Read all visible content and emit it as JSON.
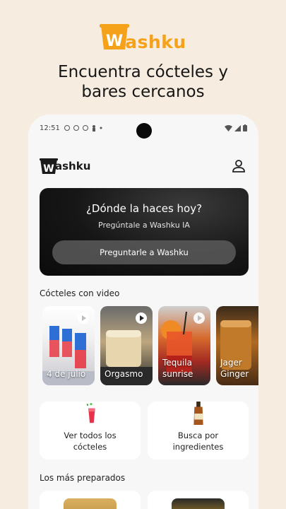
{
  "promo": {
    "brand_word": "ashku",
    "headline_line1": "Encuentra cócteles y",
    "headline_line2": "bares cercanos"
  },
  "status_bar": {
    "time": "12:51"
  },
  "app_bar": {
    "brand_word": "ashku"
  },
  "hero": {
    "title": "¿Dónde la haces hoy?",
    "subtitle": "Pregúntale a Washku IA",
    "cta_label": "Preguntarle a Washku"
  },
  "videos_section": {
    "title": "Cócteles con video",
    "items": [
      {
        "label_line1": "4 de julio",
        "label_line2": ""
      },
      {
        "label_line1": "Orgasmo",
        "label_line2": ""
      },
      {
        "label_line1": "Tequila",
        "label_line2": "sunrise"
      },
      {
        "label_line1": "Jager",
        "label_line2": "Ginger"
      }
    ]
  },
  "tiles": [
    {
      "line1": "Ver todos los",
      "line2": "cócteles",
      "icon": "cocktail-glass-icon"
    },
    {
      "line1": "Busca por",
      "line2": "ingredientes",
      "icon": "whiskey-bottle-icon"
    }
  ],
  "popular_section": {
    "title": "Los más preparados"
  },
  "colors": {
    "brand_orange": "#f5a11a",
    "background": "#f6ecdf",
    "hero_dark": "#111111"
  }
}
